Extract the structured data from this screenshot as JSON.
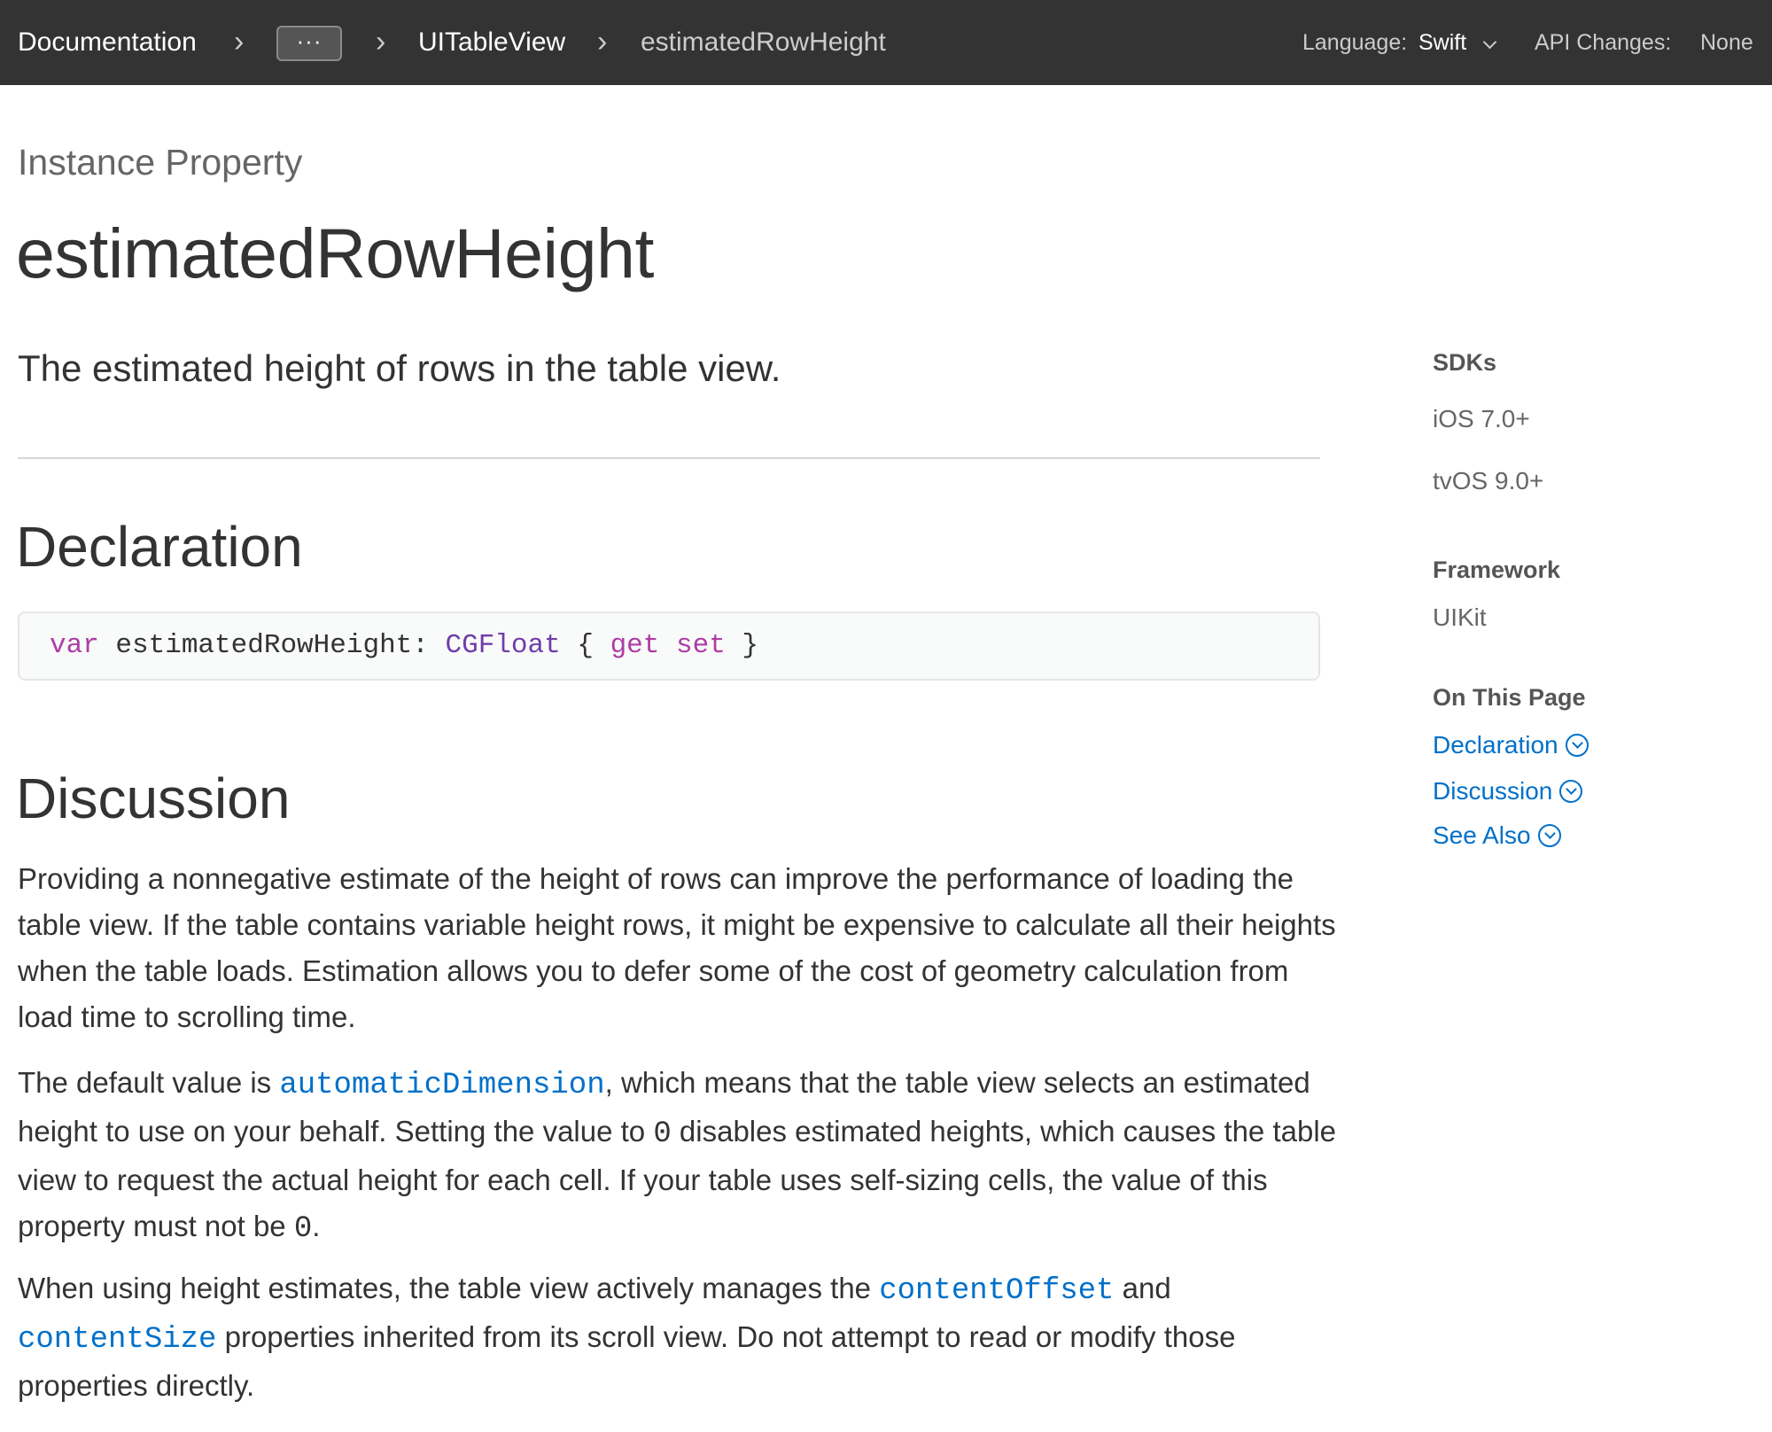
{
  "nav": {
    "breadcrumbs": [
      "Documentation",
      "UITableView",
      "estimatedRowHeight"
    ],
    "ellipsis": "···",
    "separator": "›",
    "language_label": "Language:",
    "language_value": "Swift",
    "api_changes_label": "API Changes:",
    "api_changes_value": "None"
  },
  "header": {
    "eyebrow": "Instance Property",
    "title": "estimatedRowHeight",
    "abstract": "The estimated height of rows in the table view."
  },
  "declaration": {
    "heading": "Declaration",
    "tokens": {
      "kw_var": "var",
      "name": "estimatedRowHeight:",
      "type": "CGFloat",
      "open": "{",
      "get": "get",
      "set": "set",
      "close": "}"
    }
  },
  "discussion": {
    "heading": "Discussion",
    "p1": "Providing a nonnegative estimate of the height of rows can improve the performance of loading the table view. If the table contains variable height rows, it might be expensive to calculate all their heights when the table loads. Estimation allows you to defer some of the cost of geometry calculation from load time to scrolling time.",
    "p2": {
      "t1": "The default value is ",
      "link1": "automaticDimension",
      "t2": ", which means that the table view selects an estimated height to use on your behalf. Setting the value to ",
      "code1": "0",
      "t3": " disables estimated heights, which causes the table view to request the actual height for each cell. If your table uses self-sizing cells, the value of this property must not be ",
      "code2": "0",
      "t4": "."
    },
    "p3": {
      "t1": "When using height estimates, the table view actively manages the ",
      "link1": "contentOffset",
      "t2": " and ",
      "link2": "contentSize",
      "t3": " properties inherited from its scroll view. Do not attempt to read or modify those properties directly."
    }
  },
  "sidebar": {
    "sdks_heading": "SDKs",
    "sdks": [
      "iOS 7.0+",
      "tvOS 9.0+"
    ],
    "framework_heading": "Framework",
    "framework": "UIKit",
    "on_this_page_heading": "On This Page",
    "links": [
      "Declaration",
      "Discussion",
      "See Also"
    ]
  },
  "colors": {
    "nav_bg": "#333333",
    "link": "#0070c9",
    "keyword": "#ad3da4",
    "type": "#703daa"
  }
}
